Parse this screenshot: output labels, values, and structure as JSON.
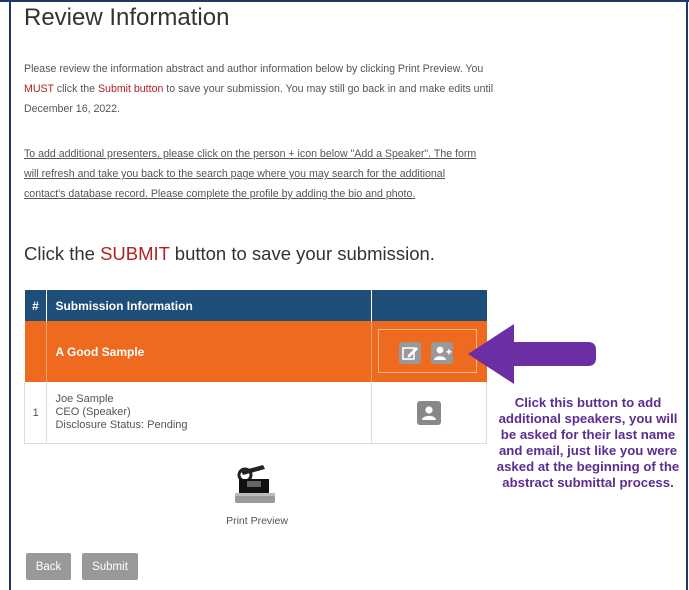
{
  "page": {
    "title": "Review Information",
    "intro": {
      "part1": "Please review the information abstract and author information below by clicking Print Preview. You ",
      "must": "MUST",
      "part2": " click the ",
      "submit_link": "Submit button",
      "part3": " to save your submission. You may still go back in and make edits until December 16, 2022."
    },
    "presenters_note": "To add additional presenters, please click on the person + icon below \"Add a Speaker\". The form will refresh and take you back to the search page where you may search for the additional contact's database record. Please complete the profile by adding the bio and photo.",
    "submit_heading": {
      "before": "Click the ",
      "keyword": "SUBMIT",
      "after": " button to save your submission."
    }
  },
  "table": {
    "headers": {
      "num": "#",
      "info": "Submission Information",
      "action": ""
    },
    "abstract_title": "A Good Sample",
    "speakers": [
      {
        "num": "1",
        "name": "Joe Sample",
        "role": "CEO (Speaker)",
        "disclosure": "Disclosure Status: Pending"
      }
    ]
  },
  "print_preview": {
    "label": "Print Preview",
    "icon": "printer-icon"
  },
  "buttons": {
    "back": "Back",
    "submit": "Submit"
  },
  "callout": {
    "text": "Click this button to add additional speakers, you will be asked for their last name and email, just like you were asked at the beginning of the abstract submittal process.",
    "color": "#5b2d91"
  },
  "colors": {
    "header_blue": "#1f4e79",
    "abstract_orange": "#ed6a1e",
    "accent_red": "#b22222",
    "button_gray": "#999999"
  }
}
